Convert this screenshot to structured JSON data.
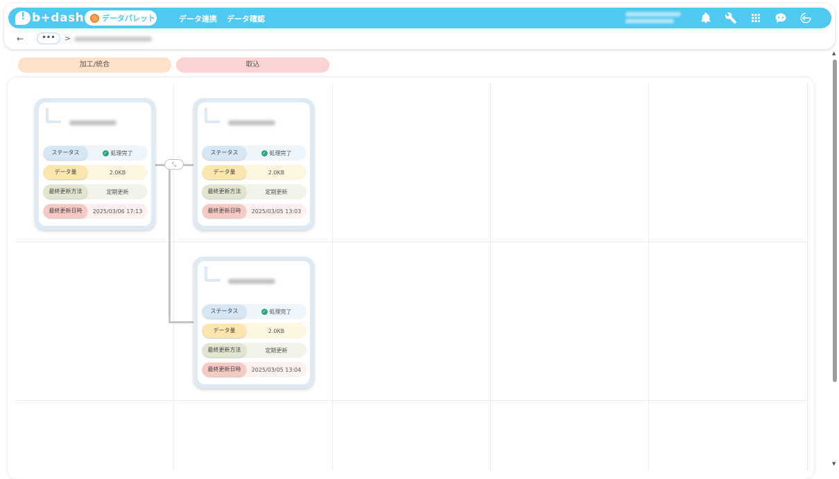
{
  "header": {
    "logo_text": "b+dash",
    "palette_label": "データパレット",
    "nav": [
      "データ連携",
      "データ確認"
    ],
    "icons": [
      "bell-icon",
      "wrench-icon",
      "apps-grid-icon",
      "chat-bot-icon",
      "logout-icon"
    ]
  },
  "breadcrumb": {
    "back": "←",
    "more": "•••",
    "separator": ">"
  },
  "columns": {
    "process": "加工/統合",
    "import": "取込"
  },
  "merge_button": "⤡",
  "labels": {
    "status": "ステータス",
    "size": "データ量",
    "method": "最終更新方法",
    "time": "最終更新日時"
  },
  "cards": [
    {
      "status": "処理完了",
      "size": "2.0KB",
      "method": "定期更新",
      "updated": "2025/03/06 17:13"
    },
    {
      "status": "処理完了",
      "size": "2.0KB",
      "method": "定期更新",
      "updated": "2025/03/05 13:03"
    },
    {
      "status": "処理完了",
      "size": "2.0KB",
      "method": "定期更新",
      "updated": "2025/03/05 13:04"
    }
  ],
  "colors": {
    "accent": "#4fc8f2",
    "status_ok": "#2fa67a",
    "process_column": "#fde2c8",
    "import_column": "#fbd3d3"
  },
  "scrollbar": {
    "up": "▲",
    "down": "▼"
  }
}
